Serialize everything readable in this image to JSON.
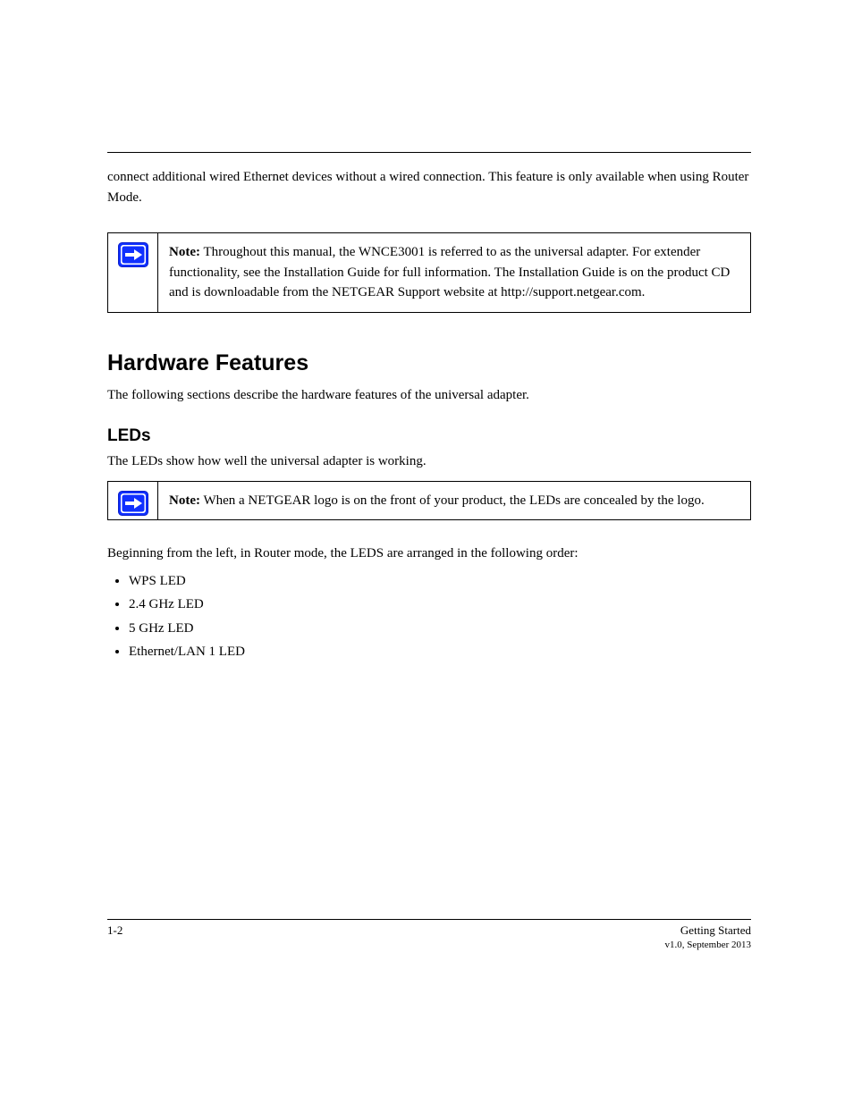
{
  "intro": "connect additional wired Ethernet devices without a wired connection. This feature is only available when using Router Mode.",
  "note1": {
    "label": "Note:",
    "text": " Throughout this manual, the WNCE3001 is referred to as the universal adapter. For extender functionality, see the Installation Guide for full information. The Installation Guide is on the product CD and is downloadable from the NETGEAR Support website at http://support.netgear.com."
  },
  "heading1": "Hardware Features",
  "para1": "The following sections describe the hardware features of the universal adapter.",
  "subheading1": "LEDs",
  "para2": "The LEDs show how well the universal adapter is working.",
  "note2": {
    "label": "Note:",
    "text": " When a NETGEAR logo is on the front of your product, the LEDs are concealed by the logo."
  },
  "list_intro": "Beginning from the left, in Router mode, the LEDS are arranged in the following order:",
  "list": [
    "WPS LED",
    "2.4 GHz LED",
    "5 GHz LED",
    "Ethernet/LAN 1 LED"
  ],
  "footer": {
    "pagenum": "1-2",
    "title": "Getting Started",
    "version": "v1.0, September 2013"
  },
  "icons": {
    "note_arrow": "note-arrow-icon"
  }
}
